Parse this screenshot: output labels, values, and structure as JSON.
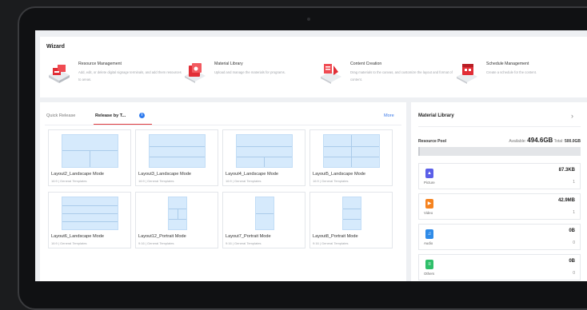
{
  "wizard": {
    "title": "Wizard",
    "items": [
      {
        "name": "Resource Management",
        "desc": "Add, edit, or delete digital signage terminals, and add them resources to areas.",
        "icon": "resource-management-icon"
      },
      {
        "name": "Material Library",
        "desc": "Upload and manage the materials for programs.",
        "icon": "material-library-icon"
      },
      {
        "name": "Content Creation",
        "desc": "Drag materials to the canvas, and customize the layout and format of content.",
        "icon": "content-creation-icon"
      },
      {
        "name": "Schedule Management",
        "desc": "Create a schedule for the content.",
        "icon": "schedule-management-icon"
      }
    ]
  },
  "release": {
    "tabs": [
      {
        "label": "Quick Release"
      },
      {
        "label": "Release by T..."
      }
    ],
    "more": "More",
    "templates": [
      {
        "title": "Layout2_Landscape Mode",
        "sub": "16:9 | General Templates"
      },
      {
        "title": "Layout3_Landscape Mode",
        "sub": "16:9 | General Templates"
      },
      {
        "title": "Layout4_Landscape Mode",
        "sub": "16:9 | General Templates"
      },
      {
        "title": "Layout5_Landscape Mode",
        "sub": "16:9 | General Templates"
      },
      {
        "title": "Layout6_Landscape Mode",
        "sub": "16:9 | General Templates"
      },
      {
        "title": "Layout12_Portrait Mode",
        "sub": "9:16 | General Templates"
      },
      {
        "title": "Layout7_Portrait Mode",
        "sub": "9:16 | General Templates"
      },
      {
        "title": "Layout8_Portrait Mode",
        "sub": "9:16 | General Templates"
      }
    ]
  },
  "library": {
    "title": "Material Library",
    "pool_label": "Resource Pool",
    "available_label": "Available:",
    "available": "494.6GB",
    "total_label": "Total:",
    "total": "500.0GB",
    "used_fraction": 0.011,
    "resources": [
      {
        "label": "Picture",
        "size": "87.3KB",
        "count": "1",
        "color": "#5b5fe8",
        "icon": "picture-icon"
      },
      {
        "label": "Video",
        "size": "42.9MB",
        "count": "1",
        "color": "#f5831f",
        "icon": "video-icon"
      },
      {
        "label": "Audio",
        "size": "0B",
        "count": "0",
        "color": "#2f8be8",
        "icon": "audio-icon"
      },
      {
        "label": "Others",
        "size": "0B",
        "count": "0",
        "color": "#2fbf6a",
        "icon": "others-icon"
      }
    ]
  }
}
